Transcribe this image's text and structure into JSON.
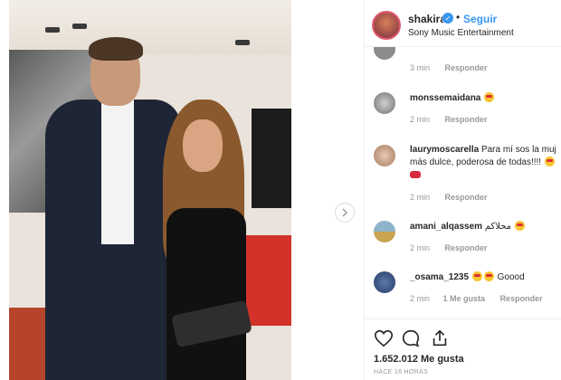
{
  "post": {
    "username": "shakira",
    "follow_label": "Seguir",
    "dot": "•",
    "subtitle": "Sony Music Entertainment"
  },
  "comments": [
    {
      "username": "",
      "text": "",
      "time": "3 min",
      "reply": "Responder",
      "likes": ""
    },
    {
      "username": "monssemaidana",
      "text": "",
      "time": "2 min",
      "reply": "Responder",
      "likes": ""
    },
    {
      "username": "laurymoscarella",
      "text": "Para mí sos la muj",
      "text2": "más dulce, poderosa de todas!!!!",
      "time": "2 min",
      "reply": "Responder",
      "likes": ""
    },
    {
      "username": "amani_alqassem",
      "text": "محلاكم",
      "time": "2 min",
      "reply": "Responder",
      "likes": ""
    },
    {
      "username": "_osama_1235",
      "text": "Goood",
      "time": "2 min",
      "reply": "Responder",
      "likes": "1 Me gusta"
    }
  ],
  "stats": {
    "likes": "1.652.012 Me gusta",
    "time_ago": "HACE 16 HORAS"
  },
  "icons": {
    "verified": "verified-badge-icon",
    "next": "chevron-right-icon",
    "like": "heart-icon",
    "comment": "comment-bubble-icon",
    "share": "share-icon"
  },
  "colors": {
    "link": "#3897f0",
    "muted": "#999999",
    "text": "#262626"
  }
}
